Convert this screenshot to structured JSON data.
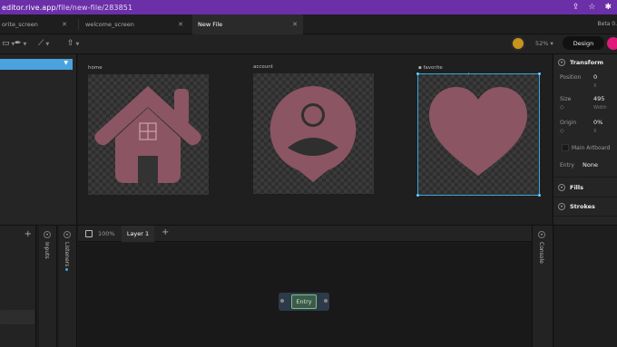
{
  "browser": {
    "url_host": "editor.rive.app",
    "url_path": "/file/new-file/283851",
    "icons": [
      "share-icon",
      "star-icon",
      "extensions-icon"
    ]
  },
  "tabs": [
    {
      "label": "orite_screen",
      "active": false
    },
    {
      "label": "welcome_screen",
      "active": false
    },
    {
      "label": "New File",
      "active": true
    }
  ],
  "beta_label": "Beta 0.",
  "toolbar": {
    "zoom": "52%",
    "design_label": "Design"
  },
  "artboards": [
    {
      "name": "home",
      "icon": "house-icon"
    },
    {
      "name": "account",
      "icon": "account-icon"
    },
    {
      "name": "favorite",
      "icon": "heart-icon",
      "selected": true
    }
  ],
  "inspector": {
    "transform": {
      "title": "Transform",
      "position_label": "Position",
      "position_x": "0",
      "position_x_sub": "X",
      "size_label": "Size",
      "size_width": "495",
      "size_width_sub": "Width",
      "origin_label": "Origin",
      "origin_x": "0%",
      "origin_x_sub": "X",
      "main_artboard_label": "Main Artboard",
      "entry_label": "Entry",
      "entry_value": "None"
    },
    "fills_title": "Fills",
    "strokes_title": "Strokes"
  },
  "bottom": {
    "inputs_label": "Inputs",
    "listeners_label": "Listeners",
    "zoom": "100%",
    "layer_tab": "Layer 1",
    "console_label": "Console",
    "entry_node": "Entry"
  },
  "colors": {
    "accent": "#4aa3df",
    "brand": "#6b2fa8",
    "icon_fill": "#8b5563",
    "selection": "#3aa6d8"
  }
}
